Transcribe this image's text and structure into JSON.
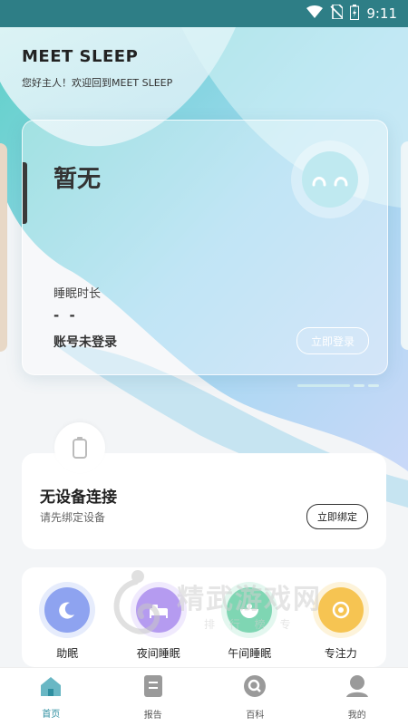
{
  "status_bar": {
    "time": "9:11"
  },
  "header": {
    "title": "MEET SLEEP",
    "greeting": "您好主人！欢迎回到MEET SLEEP"
  },
  "sleep_card": {
    "title": "暂无",
    "sleep_duration_label": "睡眠时长",
    "sleep_duration_value": "- -",
    "account_status": "账号未登录",
    "login_button": "立即登录"
  },
  "device_card": {
    "title": "无设备连接",
    "subtitle": "请先绑定设备",
    "bind_button": "立即绑定"
  },
  "features": [
    {
      "label": "助眠",
      "icon": "moon-icon",
      "color": "#8ea3f0"
    },
    {
      "label": "夜间睡眠",
      "icon": "bed-icon",
      "color": "#b59bf0"
    },
    {
      "label": "午间睡眠",
      "icon": "bowl-icon",
      "color": "#7fd6b3"
    },
    {
      "label": "专注力",
      "icon": "focus-icon",
      "color": "#f6c452"
    }
  ],
  "tabs": [
    {
      "label": "首页",
      "icon": "home-icon"
    },
    {
      "label": "报告",
      "icon": "report-icon"
    },
    {
      "label": "百科",
      "icon": "search-icon"
    },
    {
      "label": "我的",
      "icon": "profile-icon"
    }
  ],
  "watermark": {
    "text": "精武游戏网",
    "sub": "排 行 榜 专"
  },
  "colors": {
    "accent": "#2f8fa0",
    "status_bar": "#2e7e86"
  }
}
